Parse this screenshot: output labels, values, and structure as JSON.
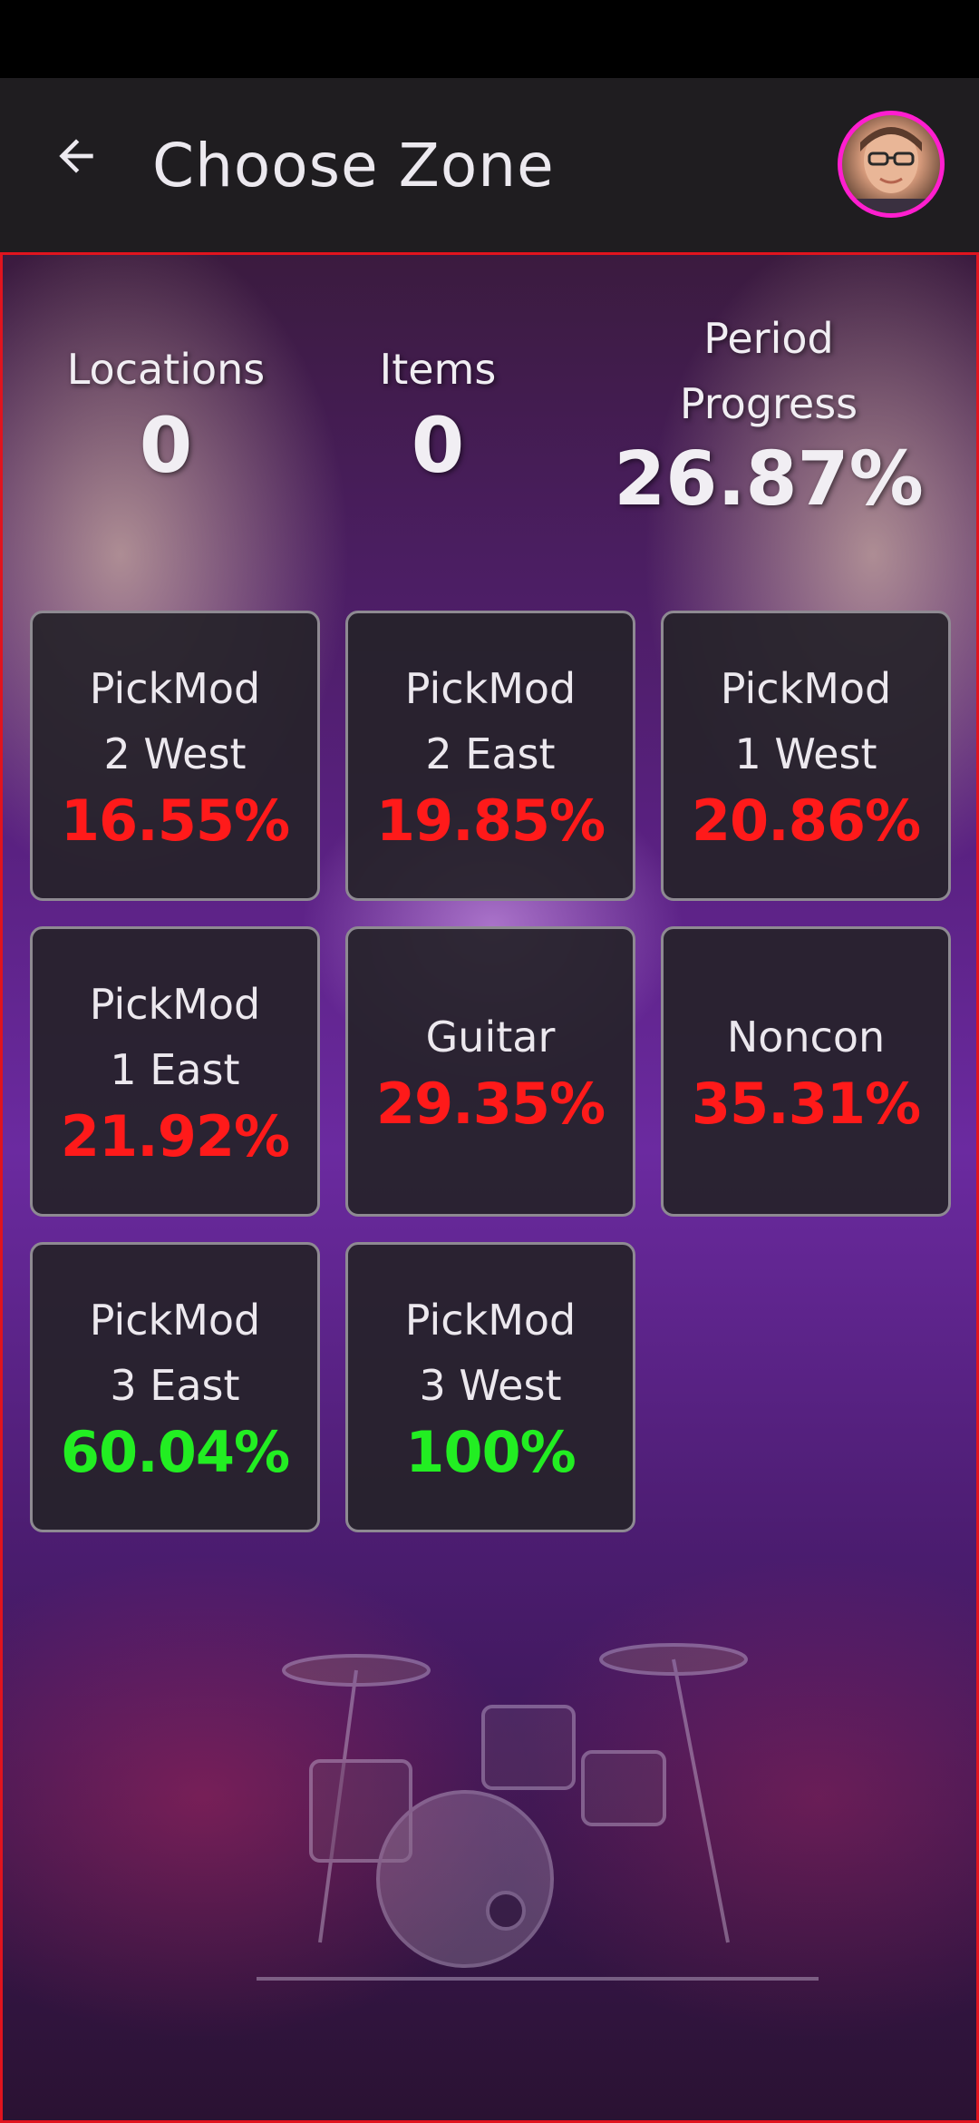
{
  "app_bar": {
    "title": "Choose Zone"
  },
  "stats": {
    "locations_label": "Locations",
    "locations_value": "0",
    "items_label": "Items",
    "items_value": "0",
    "progress_label": "Period\nProgress",
    "progress_value": "26.87%"
  },
  "zones": [
    {
      "name": "PickMod\n2 West",
      "percent": "16.55%",
      "status": "low"
    },
    {
      "name": "PickMod\n2 East",
      "percent": "19.85%",
      "status": "low"
    },
    {
      "name": "PickMod\n1 West",
      "percent": "20.86%",
      "status": "low"
    },
    {
      "name": "PickMod\n1 East",
      "percent": "21.92%",
      "status": "low"
    },
    {
      "name": "Guitar",
      "percent": "29.35%",
      "status": "low"
    },
    {
      "name": "Noncon",
      "percent": "35.31%",
      "status": "low"
    },
    {
      "name": "PickMod\n3 East",
      "percent": "60.04%",
      "status": "high"
    },
    {
      "name": "PickMod\n3 West",
      "percent": "100%",
      "status": "high"
    }
  ],
  "colors": {
    "low_percent": "#ff1a1a",
    "high_percent": "#22ee22",
    "avatar_ring": "#ff1ecf",
    "content_border": "#e0141e"
  },
  "icons": {
    "back": "arrow-left-icon"
  }
}
